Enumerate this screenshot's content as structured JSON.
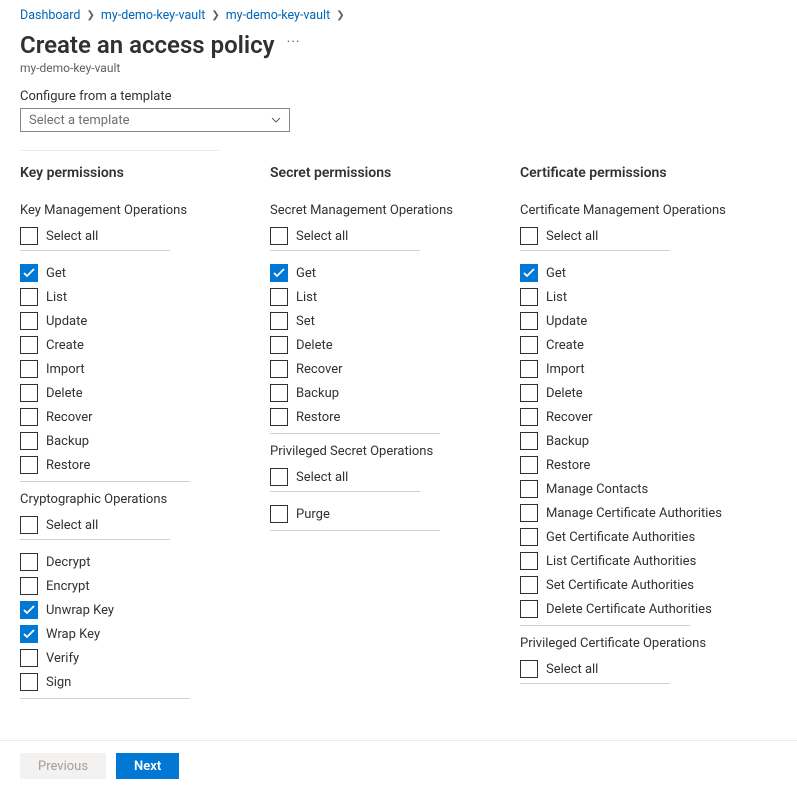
{
  "breadcrumb": {
    "items": [
      "Dashboard",
      "my-demo-key-vault",
      "my-demo-key-vault"
    ]
  },
  "page": {
    "title": "Create an access policy",
    "subtitle": "my-demo-key-vault"
  },
  "template": {
    "label": "Configure from a template",
    "placeholder": "Select a template"
  },
  "columns": {
    "key": {
      "heading": "Key permissions",
      "groups": [
        {
          "label": "Key Management Operations",
          "select_all": "Select all",
          "items": [
            {
              "label": "Get",
              "checked": true
            },
            {
              "label": "List",
              "checked": false
            },
            {
              "label": "Update",
              "checked": false
            },
            {
              "label": "Create",
              "checked": false
            },
            {
              "label": "Import",
              "checked": false
            },
            {
              "label": "Delete",
              "checked": false
            },
            {
              "label": "Recover",
              "checked": false
            },
            {
              "label": "Backup",
              "checked": false
            },
            {
              "label": "Restore",
              "checked": false
            }
          ]
        },
        {
          "label": "Cryptographic Operations",
          "select_all": "Select all",
          "items": [
            {
              "label": "Decrypt",
              "checked": false
            },
            {
              "label": "Encrypt",
              "checked": false
            },
            {
              "label": "Unwrap Key",
              "checked": true
            },
            {
              "label": "Wrap Key",
              "checked": true
            },
            {
              "label": "Verify",
              "checked": false
            },
            {
              "label": "Sign",
              "checked": false
            }
          ]
        }
      ]
    },
    "secret": {
      "heading": "Secret permissions",
      "groups": [
        {
          "label": "Secret Management Operations",
          "select_all": "Select all",
          "items": [
            {
              "label": "Get",
              "checked": true
            },
            {
              "label": "List",
              "checked": false
            },
            {
              "label": "Set",
              "checked": false
            },
            {
              "label": "Delete",
              "checked": false
            },
            {
              "label": "Recover",
              "checked": false
            },
            {
              "label": "Backup",
              "checked": false
            },
            {
              "label": "Restore",
              "checked": false
            }
          ]
        },
        {
          "label": "Privileged Secret Operations",
          "select_all": "Select all",
          "items": [
            {
              "label": "Purge",
              "checked": false
            }
          ]
        }
      ]
    },
    "cert": {
      "heading": "Certificate permissions",
      "groups": [
        {
          "label": "Certificate Management Operations",
          "select_all": "Select all",
          "items": [
            {
              "label": "Get",
              "checked": true
            },
            {
              "label": "List",
              "checked": false
            },
            {
              "label": "Update",
              "checked": false
            },
            {
              "label": "Create",
              "checked": false
            },
            {
              "label": "Import",
              "checked": false
            },
            {
              "label": "Delete",
              "checked": false
            },
            {
              "label": "Recover",
              "checked": false
            },
            {
              "label": "Backup",
              "checked": false
            },
            {
              "label": "Restore",
              "checked": false
            },
            {
              "label": "Manage Contacts",
              "checked": false
            },
            {
              "label": "Manage Certificate Authorities",
              "checked": false
            },
            {
              "label": "Get Certificate Authorities",
              "checked": false
            },
            {
              "label": "List Certificate Authorities",
              "checked": false
            },
            {
              "label": "Set Certificate Authorities",
              "checked": false
            },
            {
              "label": "Delete Certificate Authorities",
              "checked": false
            }
          ]
        },
        {
          "label": "Privileged Certificate Operations",
          "select_all": "Select all",
          "items": []
        }
      ]
    }
  },
  "footer": {
    "prev": "Previous",
    "next": "Next"
  }
}
